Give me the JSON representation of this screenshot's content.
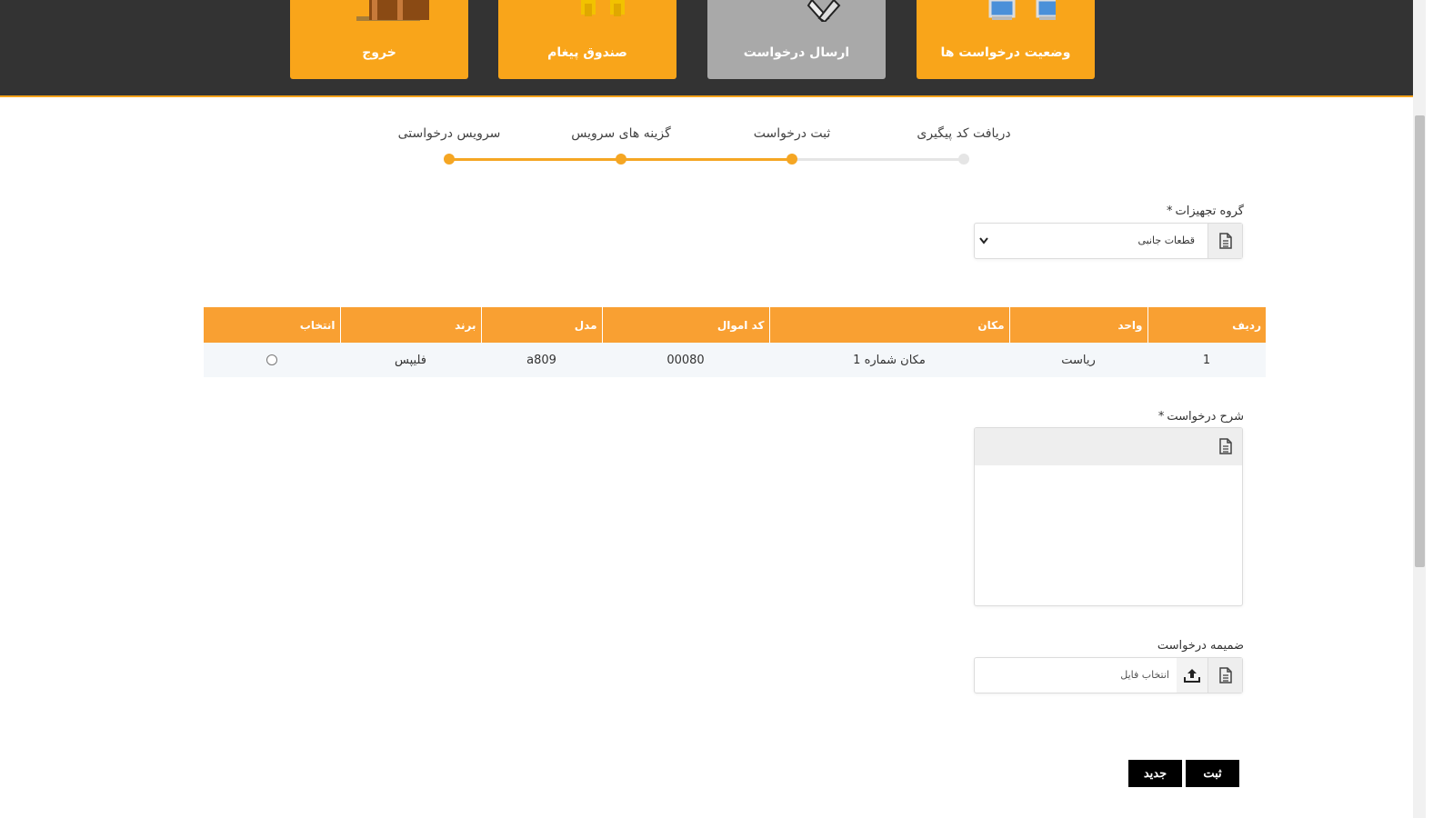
{
  "header": {
    "tiles": [
      {
        "label": "خروج",
        "icon": "door-icon"
      },
      {
        "label": "صندوق پیغام",
        "icon": "message-box-icon"
      },
      {
        "label": "ارسال درخواست",
        "icon": "tools-icon"
      },
      {
        "label": "وضعیت درخواست ها",
        "icon": "monitors-icon"
      }
    ]
  },
  "stepper": {
    "steps": [
      {
        "label": "سرویس درخواستی",
        "state": "done"
      },
      {
        "label": "گزینه های سرویس",
        "state": "done"
      },
      {
        "label": "ثبت درخواست",
        "state": "current"
      },
      {
        "label": "دریافت کد پیگیری",
        "state": "pending"
      }
    ],
    "active_color": "#f5a623",
    "inactive_color": "#e5e5e5"
  },
  "equipment_group": {
    "label": "گروه تجهیزات",
    "required_mark": "*",
    "selected_value": "قطعات جانبی"
  },
  "table": {
    "headers": [
      "ردیف",
      "واحد",
      "مکان",
      "کد اموال",
      "مدل",
      "برند",
      "انتخاب"
    ],
    "rows": [
      {
        "row_no": "1",
        "unit": "ریاست",
        "location": "مکان شماره 1",
        "asset_code": "00080",
        "model": "a809",
        "brand": "فلیپس"
      }
    ]
  },
  "description": {
    "label": "شرح درخواست",
    "required_mark": "*",
    "value": ""
  },
  "attachment": {
    "label": "ضمیمه درخواست",
    "placeholder": "انتخاب فایل"
  },
  "buttons": {
    "submit": "ثبت",
    "new": "جدید"
  },
  "colors": {
    "header_bg": "#333333",
    "tile": "#f9a51a",
    "tile_active": "#a9a9a9",
    "table_header": "#f9a032"
  }
}
